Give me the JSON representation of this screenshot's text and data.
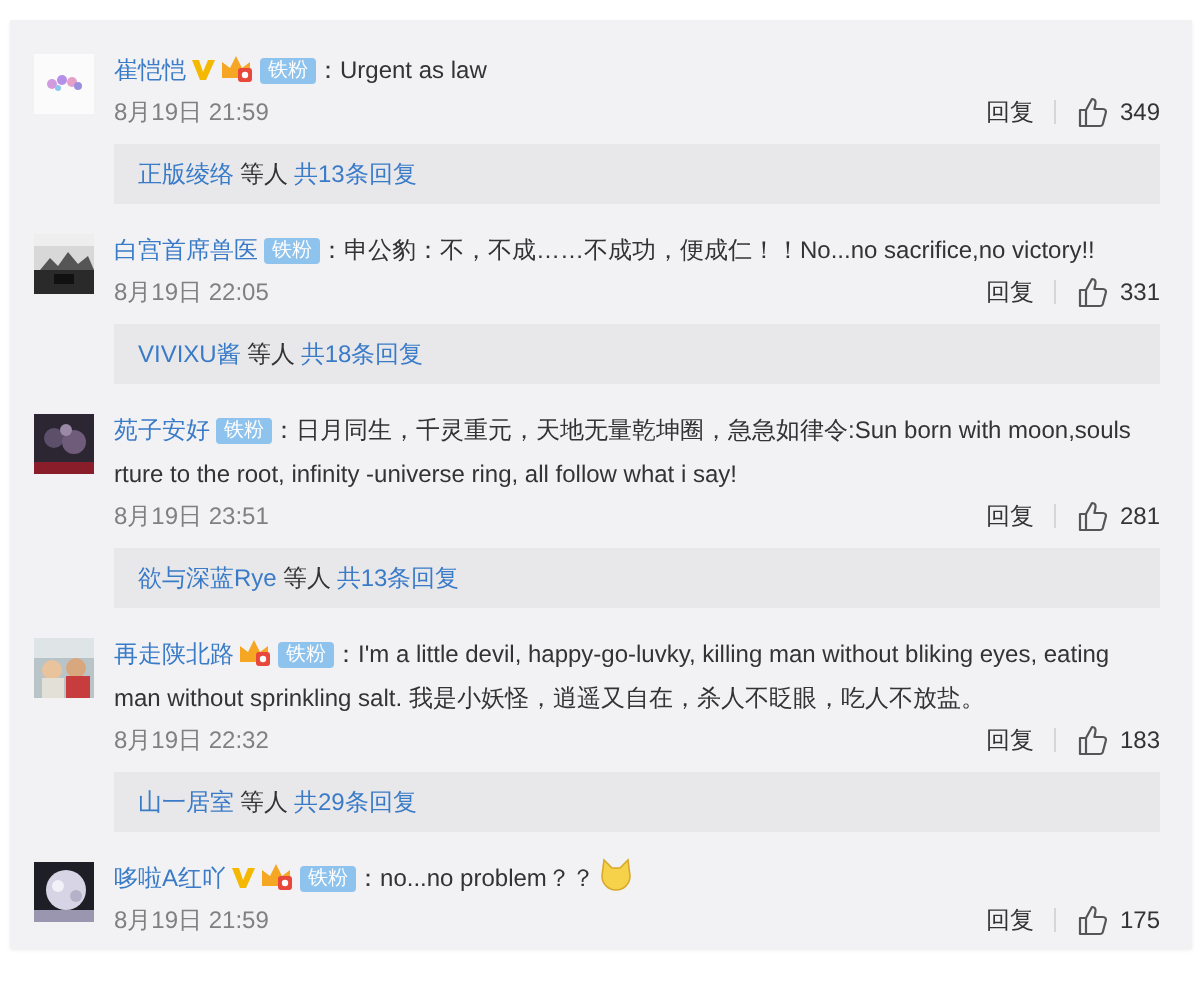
{
  "comments": [
    {
      "user": "崔恺恺",
      "verified": true,
      "crown": true,
      "fan_badge": "铁粉",
      "text_lines": [
        "：Urgent as law"
      ],
      "emoji": false,
      "time": "8月19日 21:59",
      "reply_label": "回复",
      "likes": "349",
      "replies": {
        "names": "正版绫络",
        "middle": "等人",
        "count": "共13条回复"
      }
    },
    {
      "user": "白宫首席兽医",
      "verified": false,
      "crown": false,
      "fan_badge": "铁粉",
      "text_lines": [
        "：申公豹：不，不成……不成功，便成仁！！No...no sacrifice,no victory!!"
      ],
      "emoji": false,
      "time": "8月19日 22:05",
      "reply_label": "回复",
      "likes": "331",
      "replies": {
        "names": "VIVIXU酱",
        "middle": "等人",
        "count": "共18条回复"
      }
    },
    {
      "user": "苑子安好",
      "verified": false,
      "crown": false,
      "fan_badge": "铁粉",
      "text_lines": [
        "：日月同生，千灵重元，天地无量乾坤圈，急急如律令:Sun born with moon,souls",
        "rture to the root, infinity -universe ring, all follow what i say!"
      ],
      "emoji": false,
      "time": "8月19日 23:51",
      "reply_label": "回复",
      "likes": "281",
      "replies": {
        "names": "欲与深蓝Rye",
        "middle": "等人",
        "count": "共13条回复"
      }
    },
    {
      "user": "再走陕北路",
      "verified": false,
      "crown": true,
      "fan_badge": "铁粉",
      "text_lines": [
        "：I'm a little devil, happy-go-luvky, killing man without bliking eyes, eating",
        "man without sprinkling salt. 我是小妖怪，逍遥又自在，杀人不眨眼，吃人不放盐。"
      ],
      "emoji": false,
      "time": "8月19日 22:32",
      "reply_label": "回复",
      "likes": "183",
      "replies": {
        "names": "山一居室",
        "middle": "等人",
        "count": "共29条回复"
      }
    },
    {
      "user": "哆啦A红吖",
      "verified": true,
      "crown": true,
      "fan_badge": "铁粉",
      "text_lines": [
        "：no...no  problem？？"
      ],
      "emoji": true,
      "time": "8月19日 21:59",
      "reply_label": "回复",
      "likes": "175"
    }
  ]
}
